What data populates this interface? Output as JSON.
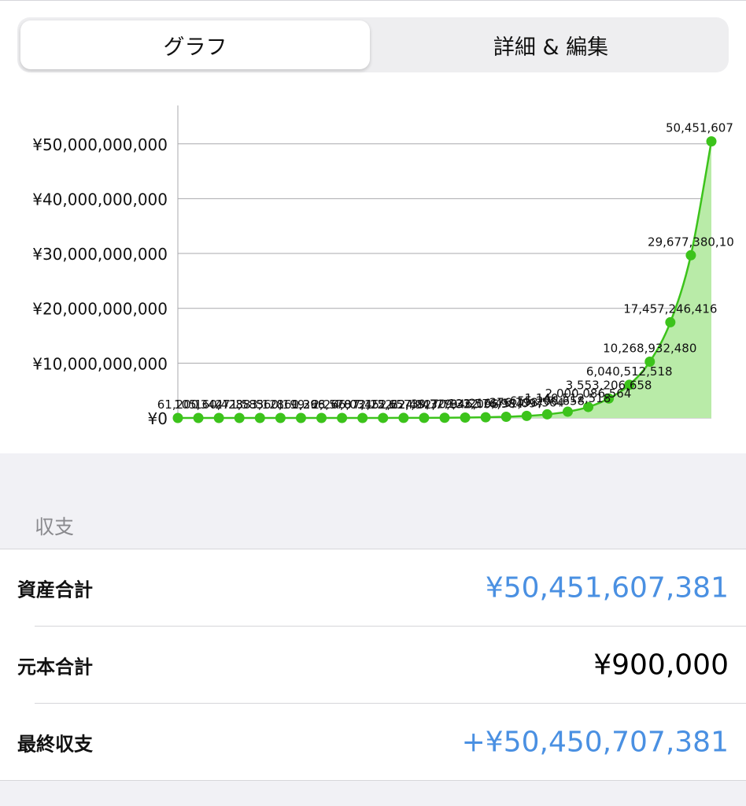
{
  "tabs": {
    "graph": "グラフ",
    "details": "詳細 & 編集"
  },
  "section": {
    "header": "収支"
  },
  "rows": [
    {
      "label": "資産合計",
      "value": "¥50,451,607,381"
    },
    {
      "label": "元本合計",
      "value": "¥900,000"
    },
    {
      "label": "最終収支",
      "value": "+¥50,450,707,381"
    }
  ],
  "colors": {
    "accent_green": "#3cc31b",
    "fill_green": "#b9eba8",
    "value_blue": "#4a90e2"
  },
  "chart_data": {
    "type": "area",
    "title": "",
    "xlabel": "",
    "ylabel": "",
    "ylim": [
      0,
      57000000000
    ],
    "yticks": [
      {
        "value": 0,
        "label": "¥0"
      },
      {
        "value": 10000000000,
        "label": "¥10,000,000,000"
      },
      {
        "value": 20000000000,
        "label": "¥20,000,000,000"
      },
      {
        "value": 30000000000,
        "label": "¥30,000,000,000"
      },
      {
        "value": 40000000000,
        "label": "¥40,000,000,000"
      },
      {
        "value": 50000000000,
        "label": "¥50,000,000,000"
      }
    ],
    "grid": true,
    "legend": "none",
    "values": [
      61200,
      105344,
      160428,
      271583,
      383121,
      560199,
      860268,
      1396578,
      2266034,
      4072252,
      7152624,
      12657943,
      22482779,
      39729322,
      70346096,
      123576984,
      216451097,
      376798564,
      655206658,
      1140512518,
      2000086564,
      3553206658,
      6040512518,
      10268932480,
      17457246416,
      29677380108,
      50451607381
    ],
    "data_labels": [
      "61,200",
      "105,344",
      "160,428",
      "271,583",
      "383,121",
      "560,199",
      "860,268",
      "1,396,578",
      "2,266,034",
      "4,072,252",
      "7,152,624",
      "12,657,943",
      "22,482,779",
      "39,729,322",
      "70,346,096",
      "123,576,984",
      "216,451,097",
      "376,798,564",
      "655,206,658",
      "1,140,512,518",
      "2,000,086,564",
      "3,553,206,658",
      "6,040,512,518",
      "10,268,932,480",
      "17,457,246,416",
      "29,677,380,10",
      "50,451,607"
    ]
  }
}
